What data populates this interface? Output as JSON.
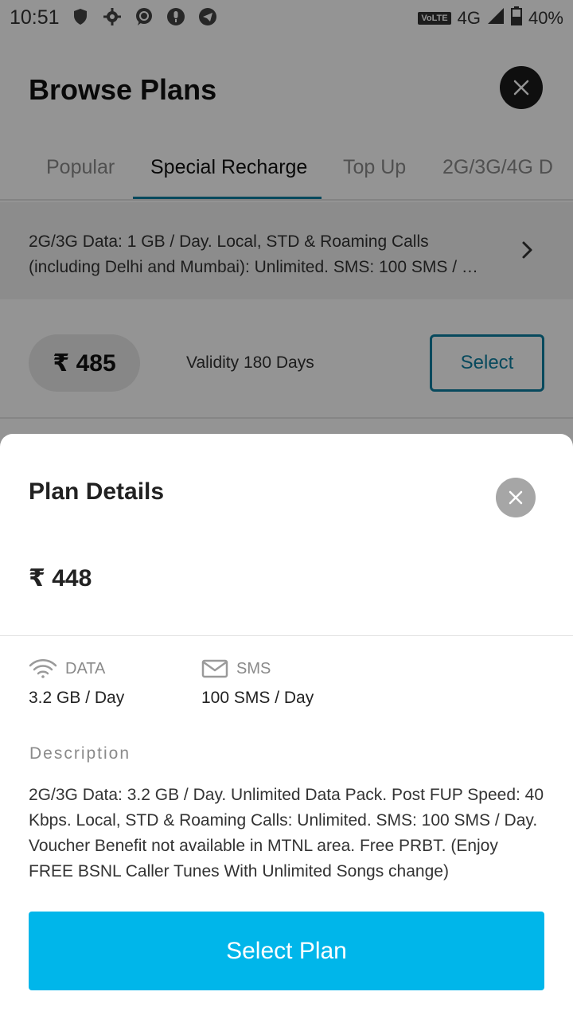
{
  "status_bar": {
    "time": "10:51",
    "network": "4G",
    "volte": "VoLTE",
    "battery": "40%",
    "notification_icons": [
      "shield-icon",
      "settings-gear-icon",
      "whatsapp-icon",
      "microphone-icon",
      "telegram-icon"
    ]
  },
  "header": {
    "title": "Browse Plans",
    "close_icon": "close-icon"
  },
  "tabs": [
    {
      "label": "Popular",
      "active": false
    },
    {
      "label": "Special Recharge",
      "active": true
    },
    {
      "label": "Top Up",
      "active": false
    },
    {
      "label": "2G/3G/4G D",
      "active": false
    }
  ],
  "plan_list_item": {
    "description": "2G/3G Data: 1 GB / Day. Local, STD & Roaming Calls (including Delhi and Mumbai): Unlimited. SMS: 100 SMS / …",
    "price": "₹ 485",
    "validity": "Validity 180 Days",
    "select_label": "Select"
  },
  "plan_details": {
    "title": "Plan Details",
    "price": "₹ 448",
    "data_label": "DATA",
    "data_value": "3.2 GB / Day",
    "sms_label": "SMS",
    "sms_value": "100 SMS / Day",
    "description_heading": "Description",
    "description": "2G/3G Data: 3.2 GB / Day. Unlimited Data Pack. Post FUP Speed: 40 Kbps. Local, STD & Roaming Calls: Unlimited. SMS: 100 SMS / Day. Voucher Benefit not available in MTNL area. Free PRBT. (Enjoy FREE BSNL Caller Tunes With Unlimited Songs change)",
    "select_plan_label": "Select Plan"
  },
  "colors": {
    "accent": "#0d7fa0",
    "primary_button": "#00b6ea",
    "scrim": "rgba(0,0,0,0.42)"
  }
}
